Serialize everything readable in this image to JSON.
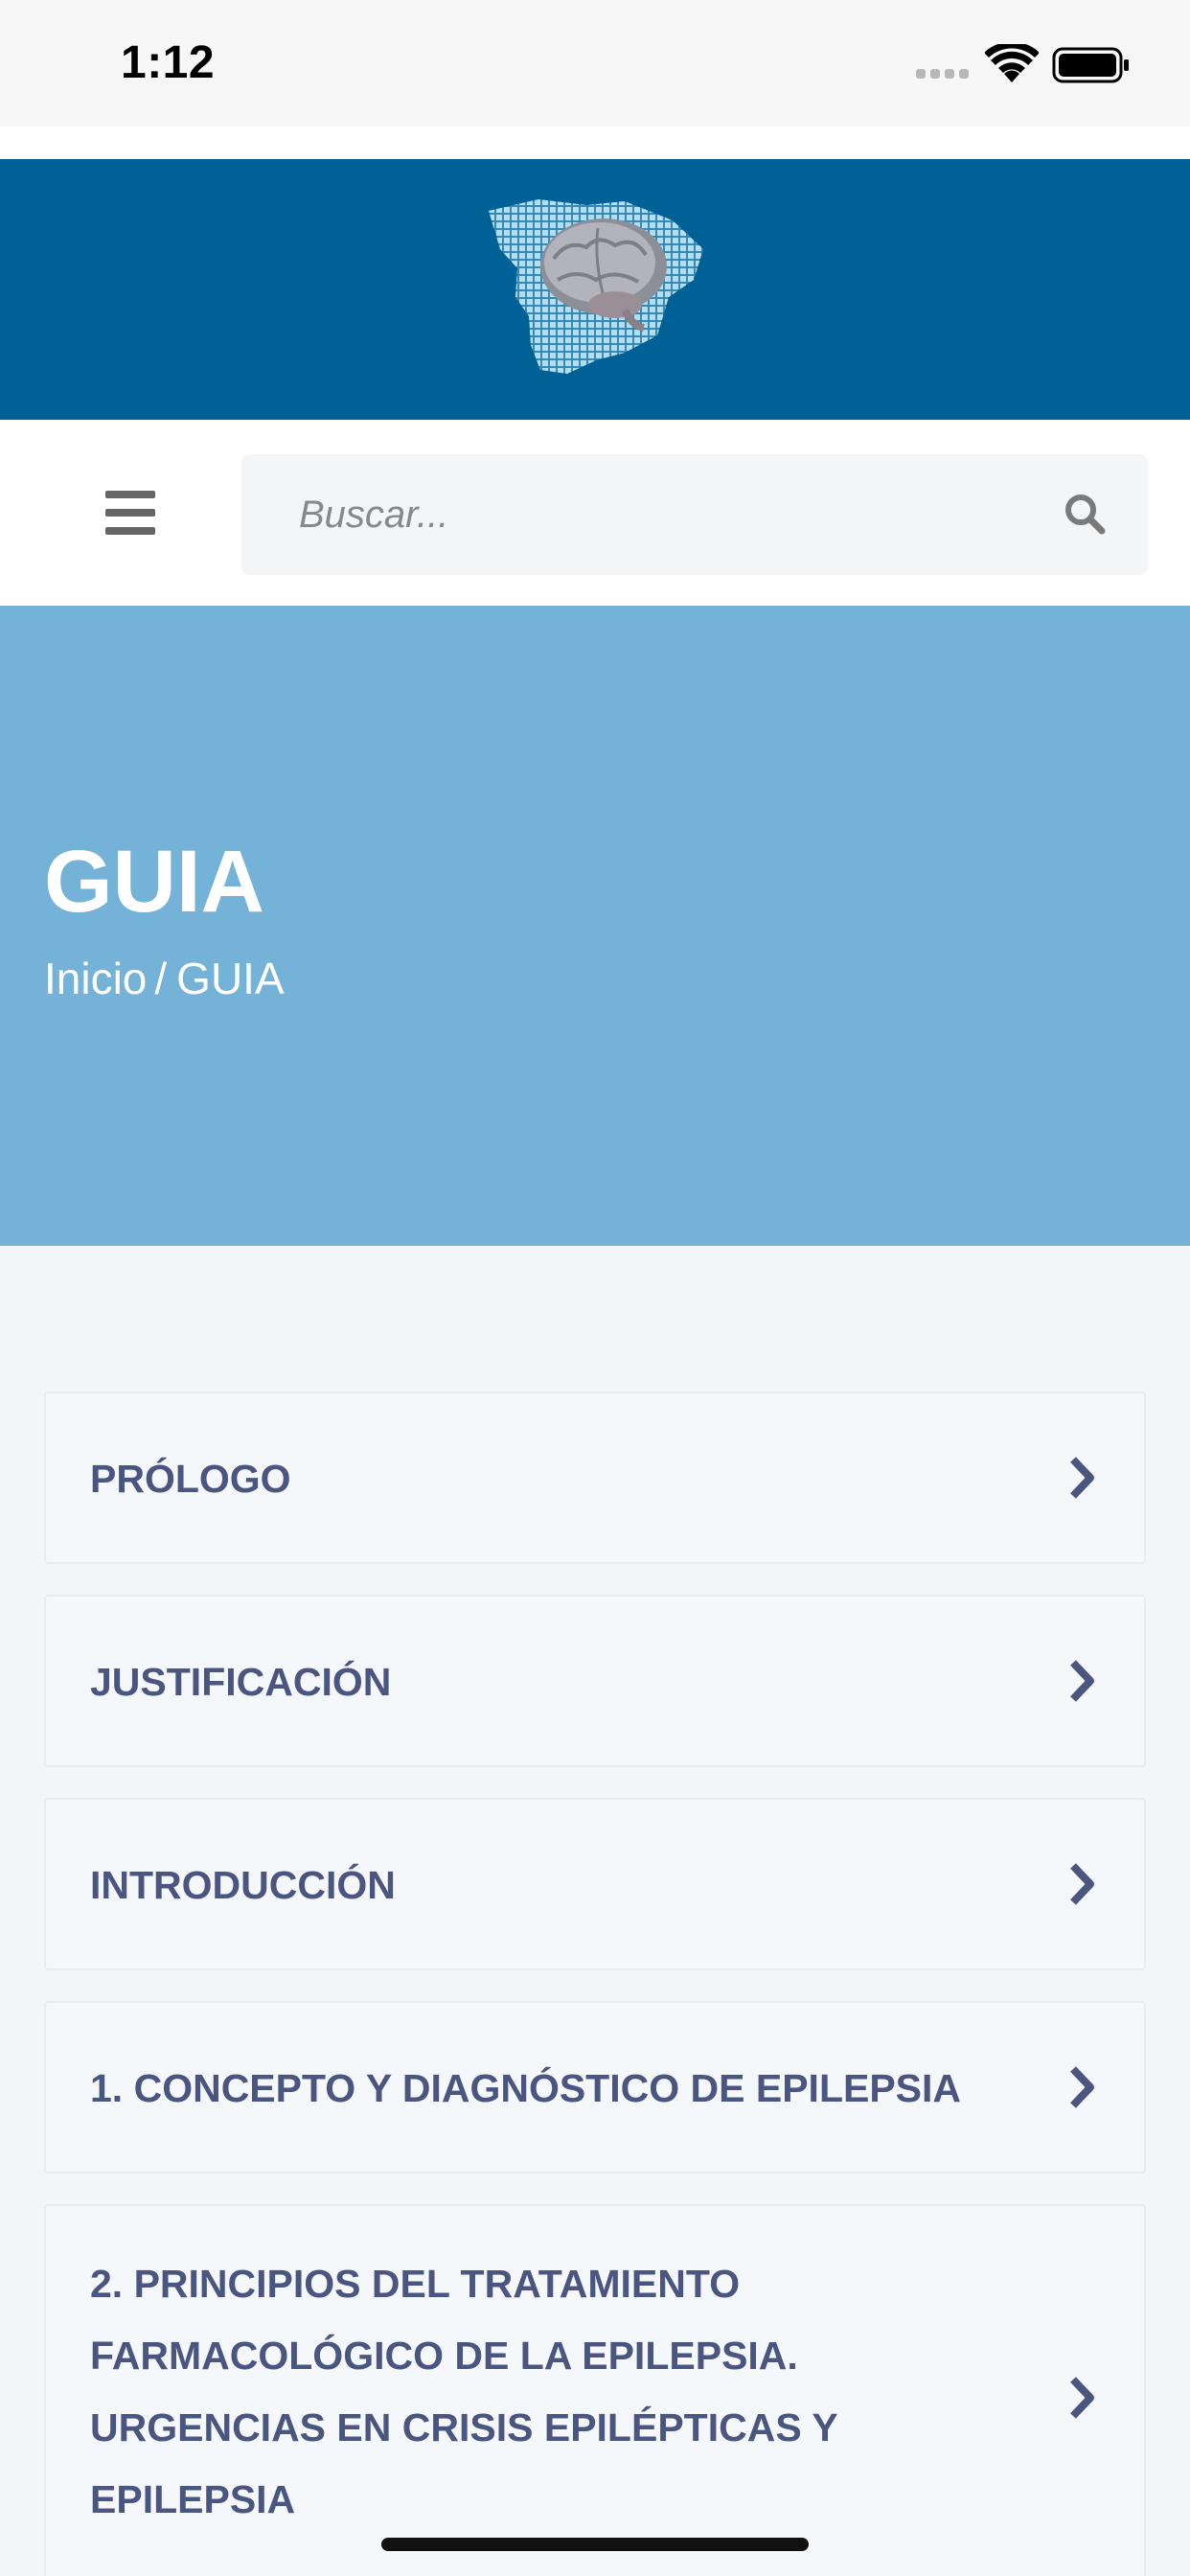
{
  "status_bar": {
    "time": "1:12"
  },
  "header": {
    "logo_icon": "brain-map-logo-icon",
    "banner_color": "#006196"
  },
  "search": {
    "menu_icon": "hamburger-menu-icon",
    "placeholder": "Buscar...",
    "value": "",
    "search_icon": "search-icon"
  },
  "hero": {
    "title": "GUIA",
    "breadcrumb": {
      "home": "Inicio",
      "separator": "/",
      "current": "GUIA"
    },
    "background_color": "#74b2d7"
  },
  "guide": {
    "items": [
      {
        "label": "PRÓLOGO"
      },
      {
        "label": "JUSTIFICACIÓN"
      },
      {
        "label": "INTRODUCCIÓN"
      },
      {
        "label": "1. CONCEPTO Y DIAGNÓSTICO DE EPILEPSIA"
      },
      {
        "label": "2. PRINCIPIOS DEL TRATAMIENTO FARMACOLÓGICO DE LA EPILEPSIA. URGENCIAS EN CRISIS EPILÉPTICAS Y EPILEPSIA"
      }
    ],
    "item_icon": "chevron-right-icon",
    "text_color": "#4a5580"
  }
}
